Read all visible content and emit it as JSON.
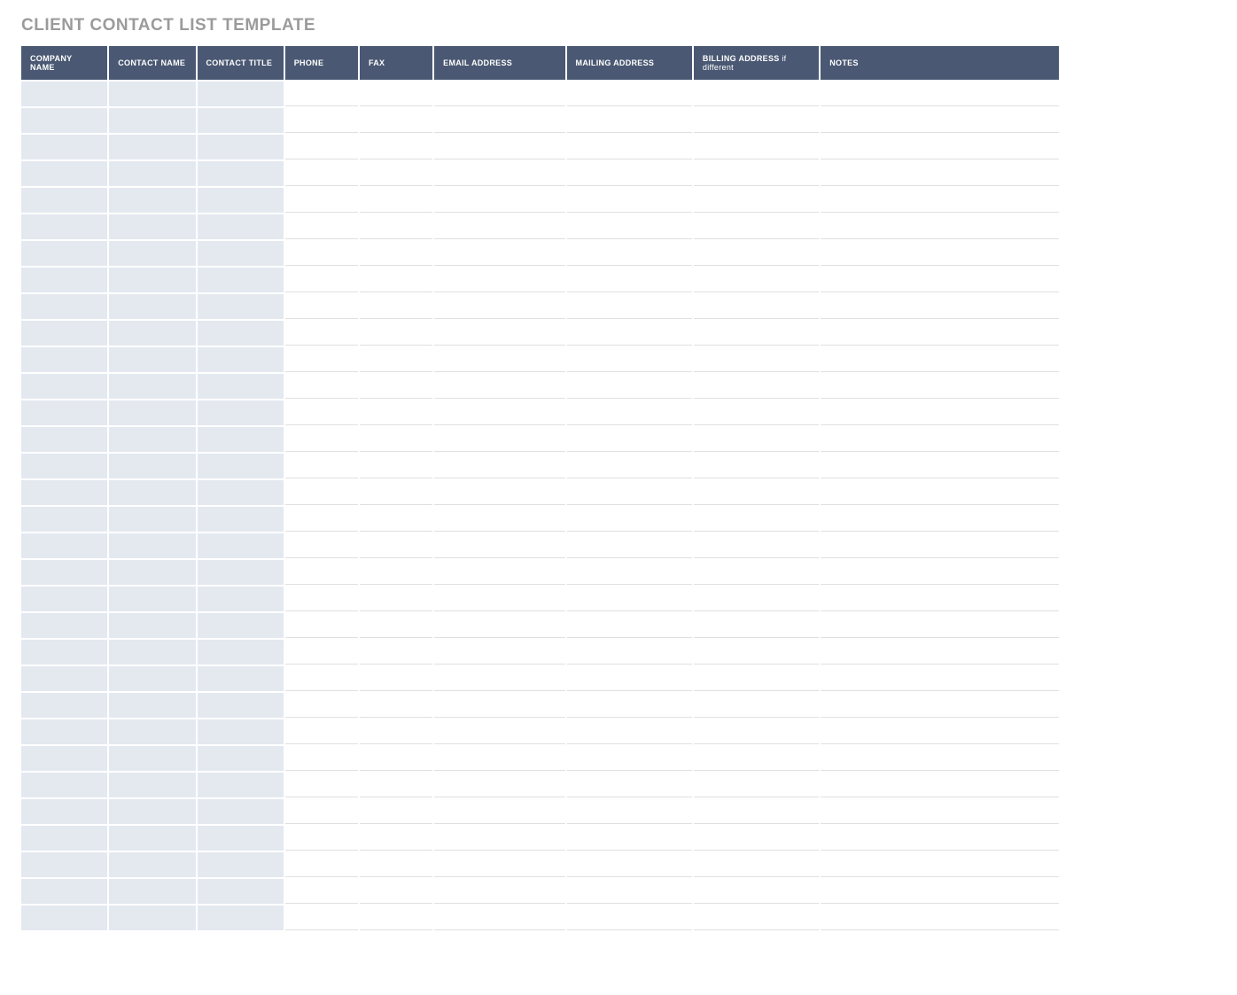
{
  "title": "CLIENT CONTACT LIST TEMPLATE",
  "columns": [
    {
      "label": "COMPANY NAME",
      "class": "col-company",
      "shaded": true
    },
    {
      "label": "CONTACT NAME",
      "class": "col-contact-name",
      "shaded": true
    },
    {
      "label": "CONTACT TITLE",
      "class": "col-contact-title",
      "shaded": true
    },
    {
      "label": "PHONE",
      "class": "col-phone",
      "shaded": false
    },
    {
      "label": "FAX",
      "class": "col-fax",
      "shaded": false
    },
    {
      "label": "EMAIL ADDRESS",
      "class": "col-email",
      "shaded": false
    },
    {
      "label": "MAILING ADDRESS",
      "class": "col-mailing",
      "shaded": false
    },
    {
      "label_bold": "BILLING ADDRESS",
      "label_light": " if different",
      "class": "col-billing",
      "shaded": false
    },
    {
      "label": "NOTES",
      "class": "col-notes",
      "shaded": false
    }
  ],
  "row_count": 32,
  "rows": [
    {
      "company_name": "",
      "contact_name": "",
      "contact_title": "",
      "phone": "",
      "fax": "",
      "email_address": "",
      "mailing_address": "",
      "billing_address": "",
      "notes": ""
    },
    {
      "company_name": "",
      "contact_name": "",
      "contact_title": "",
      "phone": "",
      "fax": "",
      "email_address": "",
      "mailing_address": "",
      "billing_address": "",
      "notes": ""
    },
    {
      "company_name": "",
      "contact_name": "",
      "contact_title": "",
      "phone": "",
      "fax": "",
      "email_address": "",
      "mailing_address": "",
      "billing_address": "",
      "notes": ""
    },
    {
      "company_name": "",
      "contact_name": "",
      "contact_title": "",
      "phone": "",
      "fax": "",
      "email_address": "",
      "mailing_address": "",
      "billing_address": "",
      "notes": ""
    },
    {
      "company_name": "",
      "contact_name": "",
      "contact_title": "",
      "phone": "",
      "fax": "",
      "email_address": "",
      "mailing_address": "",
      "billing_address": "",
      "notes": ""
    },
    {
      "company_name": "",
      "contact_name": "",
      "contact_title": "",
      "phone": "",
      "fax": "",
      "email_address": "",
      "mailing_address": "",
      "billing_address": "",
      "notes": ""
    },
    {
      "company_name": "",
      "contact_name": "",
      "contact_title": "",
      "phone": "",
      "fax": "",
      "email_address": "",
      "mailing_address": "",
      "billing_address": "",
      "notes": ""
    },
    {
      "company_name": "",
      "contact_name": "",
      "contact_title": "",
      "phone": "",
      "fax": "",
      "email_address": "",
      "mailing_address": "",
      "billing_address": "",
      "notes": ""
    },
    {
      "company_name": "",
      "contact_name": "",
      "contact_title": "",
      "phone": "",
      "fax": "",
      "email_address": "",
      "mailing_address": "",
      "billing_address": "",
      "notes": ""
    },
    {
      "company_name": "",
      "contact_name": "",
      "contact_title": "",
      "phone": "",
      "fax": "",
      "email_address": "",
      "mailing_address": "",
      "billing_address": "",
      "notes": ""
    },
    {
      "company_name": "",
      "contact_name": "",
      "contact_title": "",
      "phone": "",
      "fax": "",
      "email_address": "",
      "mailing_address": "",
      "billing_address": "",
      "notes": ""
    },
    {
      "company_name": "",
      "contact_name": "",
      "contact_title": "",
      "phone": "",
      "fax": "",
      "email_address": "",
      "mailing_address": "",
      "billing_address": "",
      "notes": ""
    },
    {
      "company_name": "",
      "contact_name": "",
      "contact_title": "",
      "phone": "",
      "fax": "",
      "email_address": "",
      "mailing_address": "",
      "billing_address": "",
      "notes": ""
    },
    {
      "company_name": "",
      "contact_name": "",
      "contact_title": "",
      "phone": "",
      "fax": "",
      "email_address": "",
      "mailing_address": "",
      "billing_address": "",
      "notes": ""
    },
    {
      "company_name": "",
      "contact_name": "",
      "contact_title": "",
      "phone": "",
      "fax": "",
      "email_address": "",
      "mailing_address": "",
      "billing_address": "",
      "notes": ""
    },
    {
      "company_name": "",
      "contact_name": "",
      "contact_title": "",
      "phone": "",
      "fax": "",
      "email_address": "",
      "mailing_address": "",
      "billing_address": "",
      "notes": ""
    },
    {
      "company_name": "",
      "contact_name": "",
      "contact_title": "",
      "phone": "",
      "fax": "",
      "email_address": "",
      "mailing_address": "",
      "billing_address": "",
      "notes": ""
    },
    {
      "company_name": "",
      "contact_name": "",
      "contact_title": "",
      "phone": "",
      "fax": "",
      "email_address": "",
      "mailing_address": "",
      "billing_address": "",
      "notes": ""
    },
    {
      "company_name": "",
      "contact_name": "",
      "contact_title": "",
      "phone": "",
      "fax": "",
      "email_address": "",
      "mailing_address": "",
      "billing_address": "",
      "notes": ""
    },
    {
      "company_name": "",
      "contact_name": "",
      "contact_title": "",
      "phone": "",
      "fax": "",
      "email_address": "",
      "mailing_address": "",
      "billing_address": "",
      "notes": ""
    },
    {
      "company_name": "",
      "contact_name": "",
      "contact_title": "",
      "phone": "",
      "fax": "",
      "email_address": "",
      "mailing_address": "",
      "billing_address": "",
      "notes": ""
    },
    {
      "company_name": "",
      "contact_name": "",
      "contact_title": "",
      "phone": "",
      "fax": "",
      "email_address": "",
      "mailing_address": "",
      "billing_address": "",
      "notes": ""
    },
    {
      "company_name": "",
      "contact_name": "",
      "contact_title": "",
      "phone": "",
      "fax": "",
      "email_address": "",
      "mailing_address": "",
      "billing_address": "",
      "notes": ""
    },
    {
      "company_name": "",
      "contact_name": "",
      "contact_title": "",
      "phone": "",
      "fax": "",
      "email_address": "",
      "mailing_address": "",
      "billing_address": "",
      "notes": ""
    },
    {
      "company_name": "",
      "contact_name": "",
      "contact_title": "",
      "phone": "",
      "fax": "",
      "email_address": "",
      "mailing_address": "",
      "billing_address": "",
      "notes": ""
    },
    {
      "company_name": "",
      "contact_name": "",
      "contact_title": "",
      "phone": "",
      "fax": "",
      "email_address": "",
      "mailing_address": "",
      "billing_address": "",
      "notes": ""
    },
    {
      "company_name": "",
      "contact_name": "",
      "contact_title": "",
      "phone": "",
      "fax": "",
      "email_address": "",
      "mailing_address": "",
      "billing_address": "",
      "notes": ""
    },
    {
      "company_name": "",
      "contact_name": "",
      "contact_title": "",
      "phone": "",
      "fax": "",
      "email_address": "",
      "mailing_address": "",
      "billing_address": "",
      "notes": ""
    },
    {
      "company_name": "",
      "contact_name": "",
      "contact_title": "",
      "phone": "",
      "fax": "",
      "email_address": "",
      "mailing_address": "",
      "billing_address": "",
      "notes": ""
    },
    {
      "company_name": "",
      "contact_name": "",
      "contact_title": "",
      "phone": "",
      "fax": "",
      "email_address": "",
      "mailing_address": "",
      "billing_address": "",
      "notes": ""
    },
    {
      "company_name": "",
      "contact_name": "",
      "contact_title": "",
      "phone": "",
      "fax": "",
      "email_address": "",
      "mailing_address": "",
      "billing_address": "",
      "notes": ""
    },
    {
      "company_name": "",
      "contact_name": "",
      "contact_title": "",
      "phone": "",
      "fax": "",
      "email_address": "",
      "mailing_address": "",
      "billing_address": "",
      "notes": ""
    }
  ]
}
